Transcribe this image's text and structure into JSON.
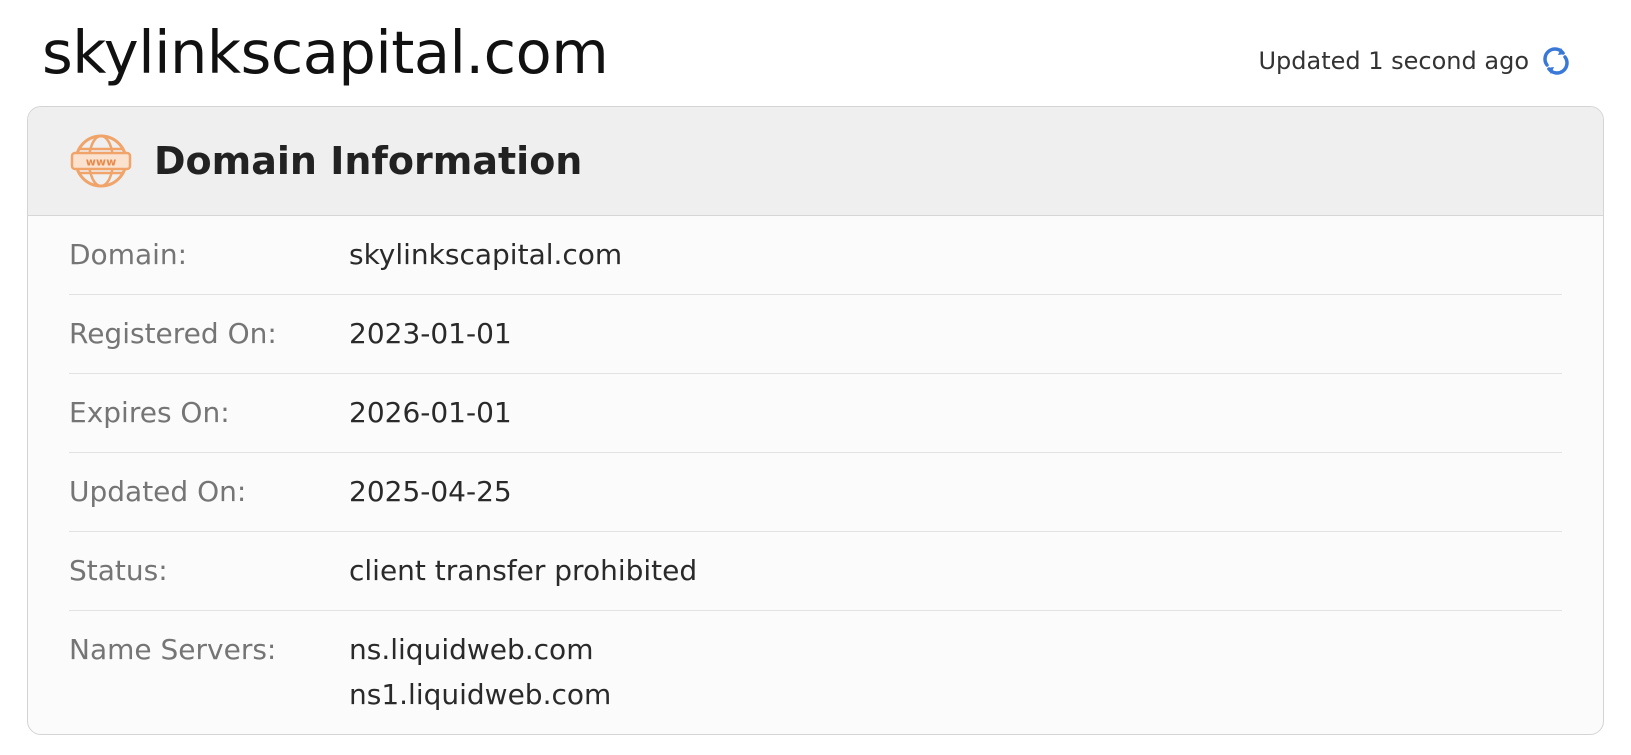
{
  "page": {
    "title": "skylinkscapital.com",
    "updated_text": "Updated 1 second ago"
  },
  "card": {
    "title": "Domain Information",
    "icon": "www-icon",
    "accent_color": "#f0a46a",
    "refresh_color": "#3a78d8",
    "rows": [
      {
        "label": "Domain:",
        "value": "skylinkscapital.com"
      },
      {
        "label": "Registered On:",
        "value": "2023-01-01"
      },
      {
        "label": "Expires On:",
        "value": "2026-01-01"
      },
      {
        "label": "Updated On:",
        "value": "2025-04-25"
      },
      {
        "label": "Status:",
        "value": "client transfer prohibited"
      },
      {
        "label": "Name Servers:",
        "values": [
          "ns.liquidweb.com",
          "ns1.liquidweb.com"
        ]
      }
    ]
  }
}
